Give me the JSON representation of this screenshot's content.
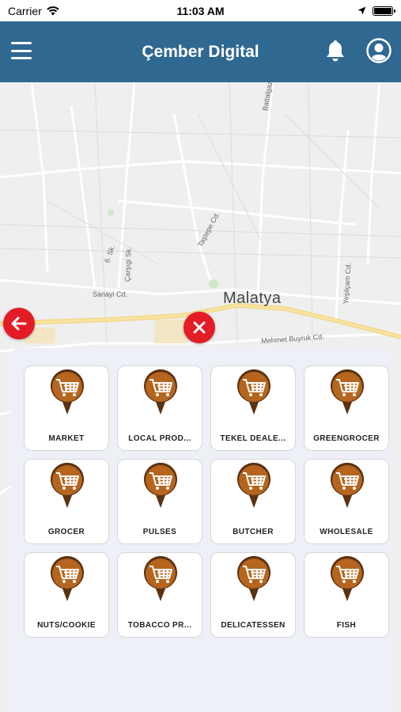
{
  "status_bar": {
    "carrier": "Carrier",
    "time": "11:03 AM"
  },
  "header": {
    "title": "Çember Digital",
    "menu_icon": "hamburger-icon",
    "bell_icon": "bell-icon",
    "user_icon": "user-icon"
  },
  "map": {
    "city": "Malatya",
    "streets": [
      "Battalgazi Cd.",
      "Taştepe Cd.",
      "Çarşıgi Sk.",
      "6. Sk.",
      "Sanayi Cd.",
      "Yeşilçam Cd.",
      "Mehmet Buyruk Cd."
    ],
    "back_icon": "arrow-left-icon",
    "close_icon": "close-icon"
  },
  "colors": {
    "header": "#2f6890",
    "pin": "#b5651d",
    "action_red": "#e41c25",
    "panel": "#eef0f7"
  },
  "categories": [
    {
      "label": "MARKET",
      "icon": "cart-pin-icon"
    },
    {
      "label": "LOCAL PROD...",
      "icon": "cart-pin-icon"
    },
    {
      "label": "TEKEL DEALE...",
      "icon": "cart-pin-icon"
    },
    {
      "label": "GREENGROCER",
      "icon": "cart-pin-icon"
    },
    {
      "label": "GROCER",
      "icon": "cart-pin-icon"
    },
    {
      "label": "PULSES",
      "icon": "cart-pin-icon"
    },
    {
      "label": "BUTCHER",
      "icon": "cart-pin-icon"
    },
    {
      "label": "WHOLESALE",
      "icon": "cart-pin-icon"
    },
    {
      "label": "NUTS/COOKIE",
      "icon": "cart-pin-icon"
    },
    {
      "label": "TOBACCO PR...",
      "icon": "cart-pin-icon"
    },
    {
      "label": "DELICATESSEN",
      "icon": "cart-pin-icon"
    },
    {
      "label": "FISH",
      "icon": "cart-pin-icon"
    }
  ]
}
